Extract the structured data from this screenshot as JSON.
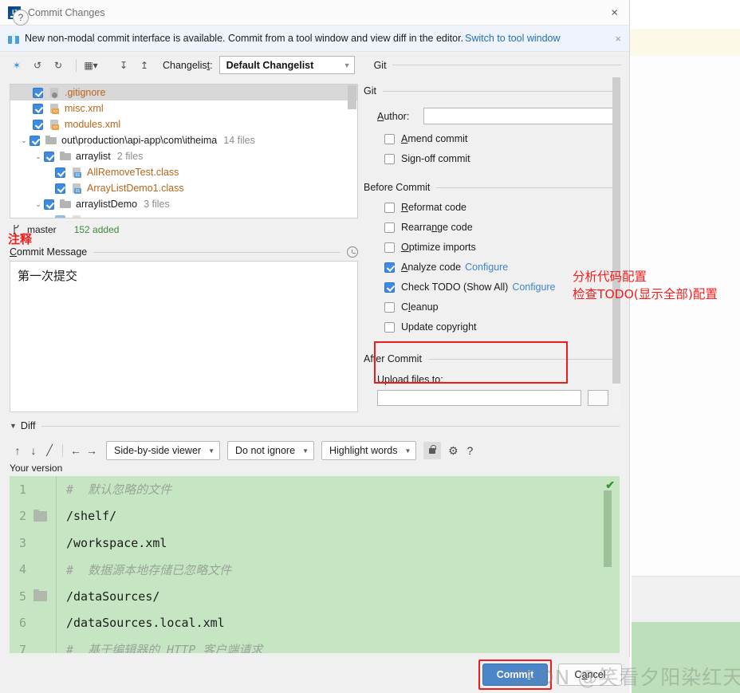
{
  "window": {
    "title": "Commit Changes",
    "logo_icon": "intellij-idea-logo-icon",
    "close_icon": "×"
  },
  "notification": {
    "icon": "gift-icon",
    "text": "New non-modal commit interface is available. Commit from a tool window and view diff in the editor.",
    "link": "Switch to tool window",
    "close_icon": "×"
  },
  "toolbar": {
    "icons": [
      "collapse-changes-icon",
      "revert-icon",
      "refresh-icon",
      "group-by-icon",
      "expand-all-icon",
      "collapse-all-icon"
    ],
    "glyphs": [
      "✦",
      "↺",
      "↻",
      "⁙",
      "↧",
      "↥"
    ],
    "changelist_label": "Changelist:",
    "changelist_value": "Default Changelist",
    "dropdown_arrow": "▼",
    "git_label": "Git"
  },
  "tree": {
    "rows": [
      {
        "indent": 0,
        "twisty": "",
        "name": ".gitignore",
        "kind": "file",
        "badge": "gi",
        "count": "",
        "selected": true
      },
      {
        "indent": 0,
        "twisty": "",
        "name": "misc.xml",
        "kind": "file",
        "badge": "<>",
        "count": "",
        "selected": false
      },
      {
        "indent": 0,
        "twisty": "",
        "name": "modules.xml",
        "kind": "file",
        "badge": "<>",
        "count": "",
        "selected": false
      },
      {
        "indent": 0,
        "twisty": "⌄",
        "name": "out\\production\\api-app\\com\\itheima",
        "kind": "dir",
        "badge": "",
        "count": "14 files",
        "selected": false
      },
      {
        "indent": 1,
        "twisty": "⌄",
        "name": "arraylist",
        "kind": "dir",
        "badge": "",
        "count": "2 files",
        "selected": false
      },
      {
        "indent": 2,
        "twisty": "",
        "name": "AllRemoveTest.class",
        "kind": "file",
        "badge": "01",
        "count": "",
        "selected": false
      },
      {
        "indent": 2,
        "twisty": "",
        "name": "ArrayListDemo1.class",
        "kind": "file",
        "badge": "01",
        "count": "",
        "selected": false
      },
      {
        "indent": 1,
        "twisty": "⌄",
        "name": "arraylistDemo",
        "kind": "dir",
        "badge": "",
        "count": "3 files",
        "selected": false
      }
    ]
  },
  "branch": {
    "icon": "git-branch-icon",
    "name": "master",
    "added": "152 added"
  },
  "annotations": {
    "zhushi": "注释",
    "right_line1": "分析代码配置",
    "right_line2": "检查TODO(显示全部)配置",
    "accent_color": "#f41c1c"
  },
  "commit_message": {
    "label_prefix": "C",
    "label_rest": "ommit Message",
    "history_icon": "clock-icon",
    "value": "第一次提交"
  },
  "git_section": {
    "title": "Git",
    "author_label_u": "A",
    "author_label_rest": "uthor:",
    "author_value": "",
    "checkboxes": [
      {
        "label_u": "A",
        "label_pre": "",
        "label_rest": "mend commit",
        "checked": false
      },
      {
        "label_u": "g",
        "label_pre": "Si",
        "label_rest": "n-off commit",
        "checked": false
      }
    ]
  },
  "before_commit": {
    "title": "Before Commit",
    "items": [
      {
        "label_pre": "",
        "label_u": "R",
        "label_rest": "eformat code",
        "checked": false,
        "link": ""
      },
      {
        "label_pre": "Rearra",
        "label_u": "n",
        "label_rest": "ge code",
        "checked": false,
        "link": ""
      },
      {
        "label_pre": "",
        "label_u": "O",
        "label_rest": "ptimize imports",
        "checked": false,
        "link": ""
      },
      {
        "label_pre": "",
        "label_u": "A",
        "label_rest": "nalyze code",
        "checked": true,
        "link": "Configure"
      },
      {
        "label_pre": "Check TODO (Show All)",
        "label_u": "",
        "label_rest": "",
        "checked": true,
        "link": "Configure"
      },
      {
        "label_pre": "C",
        "label_u": "l",
        "label_rest": "eanup",
        "checked": false,
        "link": ""
      },
      {
        "label_pre": "Update copyright",
        "label_u": "",
        "label_rest": "",
        "checked": false,
        "link": ""
      }
    ]
  },
  "after_commit": {
    "title": "After Commit",
    "upload_label": "Upload files to:",
    "upload_value": ""
  },
  "diff": {
    "section_label": "Diff",
    "caret": "▼",
    "nav_icons": [
      "prev-difference-icon",
      "next-difference-icon",
      "edit-source-icon",
      "apply-left-icon",
      "apply-right-icon"
    ],
    "nav_glyphs": [
      "↑",
      "↓",
      "╱",
      "←",
      "→"
    ],
    "viewer_mode": "Side-by-side viewer",
    "ignore_mode": "Do not ignore",
    "highlight_mode": "Highlight words",
    "lock_icon": "lock-icon",
    "settings_icon": "gear-icon",
    "help_icon": "?",
    "your_version_label": "Your version",
    "check_glyph": "✔",
    "lines": [
      {
        "num": "1",
        "folder": false,
        "text": "#  默认忽略的文件",
        "comment": true
      },
      {
        "num": "2",
        "folder": true,
        "text": "/shelf/",
        "comment": false
      },
      {
        "num": "3",
        "folder": false,
        "text": "/workspace.xml",
        "comment": false
      },
      {
        "num": "4",
        "folder": false,
        "text": "#  数据源本地存储已忽略文件",
        "comment": true
      },
      {
        "num": "5",
        "folder": true,
        "text": "/dataSources/",
        "comment": false
      },
      {
        "num": "6",
        "folder": false,
        "text": "/dataSources.local.xml",
        "comment": false
      },
      {
        "num": "7",
        "folder": false,
        "text": "#  基于编辑器的 HTTP 客户端请求",
        "comment": true
      }
    ]
  },
  "footer": {
    "help_glyph": "?",
    "commit_pre": "Comm",
    "commit_u": "i",
    "commit_rest": "t",
    "cancel_pre": "C",
    "cancel_u": "a",
    "cancel_rest": "ncel"
  },
  "watermark": {
    "text": "CSDN @笑看夕阳染红天"
  }
}
